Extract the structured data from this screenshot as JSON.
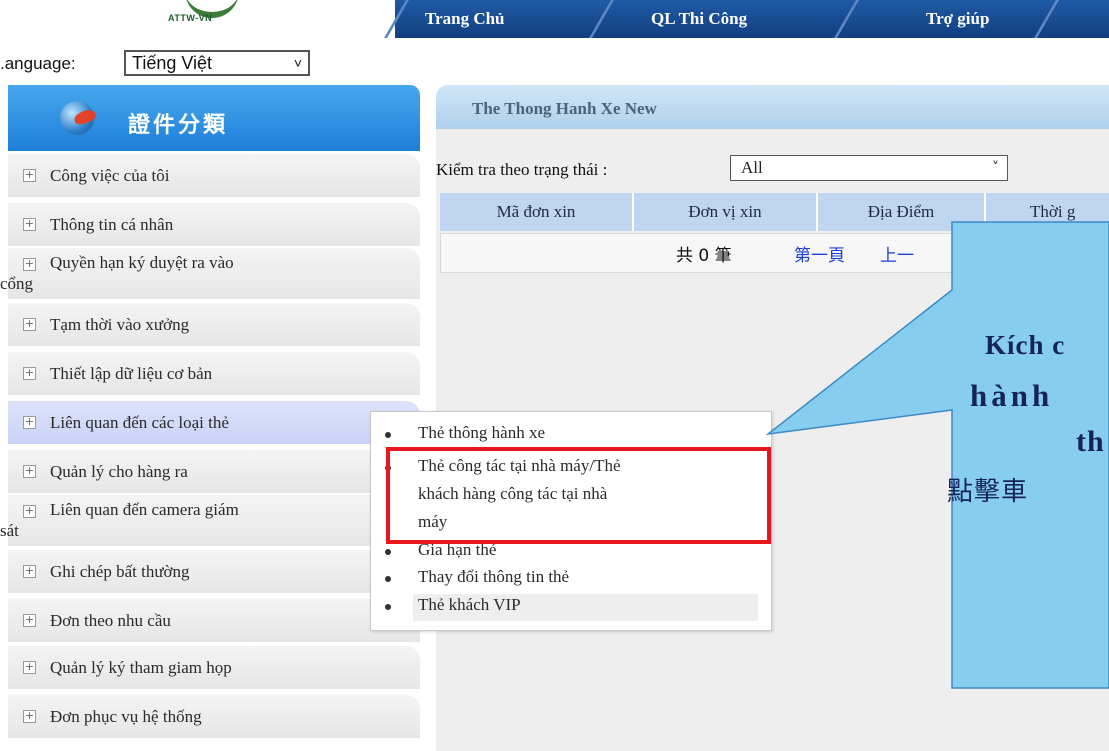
{
  "header": {
    "logo_text": "ATTW-VN",
    "nav": [
      "Trang Chủ",
      "QL Thi Công",
      "Trợ giúp"
    ]
  },
  "language": {
    "label": ".anguage:",
    "selected": "Tiếng Việt"
  },
  "sidebar": {
    "title": "證件分類",
    "items": [
      {
        "label": "Công việc của tôi"
      },
      {
        "label": "Thông tin cá nhân"
      },
      {
        "label": "Quyền hạn ký duyệt ra vào",
        "label2": "cổng"
      },
      {
        "label": "Tạm thời vào xưởng"
      },
      {
        "label": "Thiết lập dữ liệu cơ bản"
      },
      {
        "label": "Liên quan đến các loại thẻ"
      },
      {
        "label": "Quản lý cho hàng ra"
      },
      {
        "label": "Liên quan đến camera giám",
        "label2": "sát"
      },
      {
        "label": "Ghi chép bất thường"
      },
      {
        "label": "Đơn theo nhu cầu"
      },
      {
        "label": "Quản lý ký tham giam họp"
      },
      {
        "label": "Đơn phục vụ hệ thống"
      }
    ]
  },
  "content": {
    "title": "The Thong Hanh Xe New",
    "filter_label": "Kiểm tra theo trạng thái :",
    "filter_value": "All",
    "columns": [
      "Mã đơn xin",
      "Đơn vị xin",
      "Địa Điểm",
      "Thời g"
    ],
    "count_text": "共 0 筆",
    "first_page": "第一頁",
    "prev_page": "上一"
  },
  "submenu": {
    "items": [
      {
        "lines": [
          "Thẻ thông hành xe"
        ]
      },
      {
        "lines": [
          "Thẻ công tác tại nhà máy/Thẻ",
          "khách hàng công tác tại nhà",
          "máy"
        ]
      },
      {
        "lines": [
          "Gia hạn thẻ"
        ]
      },
      {
        "lines": [
          "Thay đổi thông tin thẻ"
        ]
      },
      {
        "lines": [
          "Thẻ khách VIP"
        ]
      }
    ]
  },
  "callout": {
    "lines": [
      "Kích c",
      "hành ",
      "th",
      "點擊車"
    ]
  },
  "colors": {
    "nav_bg": "#1f5aa6",
    "sidebar_head": "#2d8fe0",
    "highlight_box": "#e8161d",
    "callout_fill": "#87cdf0"
  }
}
